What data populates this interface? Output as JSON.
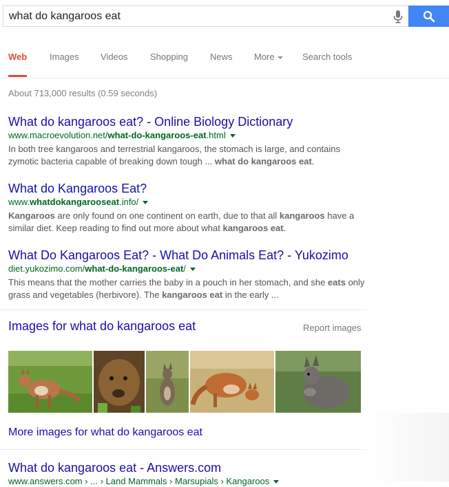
{
  "search": {
    "query": "what do kangaroos eat"
  },
  "tabs": [
    {
      "label": "Web"
    },
    {
      "label": "Images"
    },
    {
      "label": "Videos"
    },
    {
      "label": "Shopping"
    },
    {
      "label": "News"
    },
    {
      "label": "More"
    },
    {
      "label": "Search tools"
    }
  ],
  "stats": "About 713,000 results (0.59 seconds)",
  "results": [
    {
      "title": "What do kangaroos eat? - Online Biology Dictionary",
      "url_prefix": "www.macroevolution.net/",
      "url_bold": "what-do-kangaroos-eat",
      "url_suffix": ".html",
      "snippet_1": "In both tree kangaroos and terrestrial kangaroos, the stomach is large, and contains zymotic bacteria capable of breaking down tough ... ",
      "snippet_bold_1": "what do kangaroos eat",
      "snippet_2": "."
    },
    {
      "title": "What do Kangaroos Eat?",
      "url_prefix": "www.",
      "url_bold": "whatdokangarooseat",
      "url_suffix": ".info/",
      "snippet_bold_1": "Kangaroos",
      "snippet_1": " are only found on one continent on earth, due to that all ",
      "snippet_bold_2": "kangaroos",
      "snippet_2": " have a similar diet. Keep reading to find out more about what ",
      "snippet_bold_3": "kangaroos eat",
      "snippet_3": "."
    },
    {
      "title": "What Do Kangaroos Eat? - What Do Animals Eat? - Yukozimo",
      "url_prefix": "diet.yukozimo.com/",
      "url_bold": "what-do-kangaroos-eat",
      "url_suffix": "/",
      "snippet_1": "This means that the mother carries the baby in a pouch in her stomach, and she ",
      "snippet_bold_1": "eats",
      "snippet_2": " only grass and vegetables (herbivore). The ",
      "snippet_bold_2": "kangaroos eat",
      "snippet_3": " in the early ..."
    },
    {
      "title": "What do kangaroos eat - Answers.com",
      "url_text": "www.answers.com › ... › Land Mammals › Marsupials › Kangaroos"
    }
  ],
  "images": {
    "heading": "Images for what do kangaroos eat",
    "report": "Report images",
    "more": "More images for what do kangaroos eat"
  },
  "colors": {
    "link": "#1a0dab",
    "url": "#006621",
    "active_tab": "#dd4b39",
    "search_button": "#4285f4"
  }
}
